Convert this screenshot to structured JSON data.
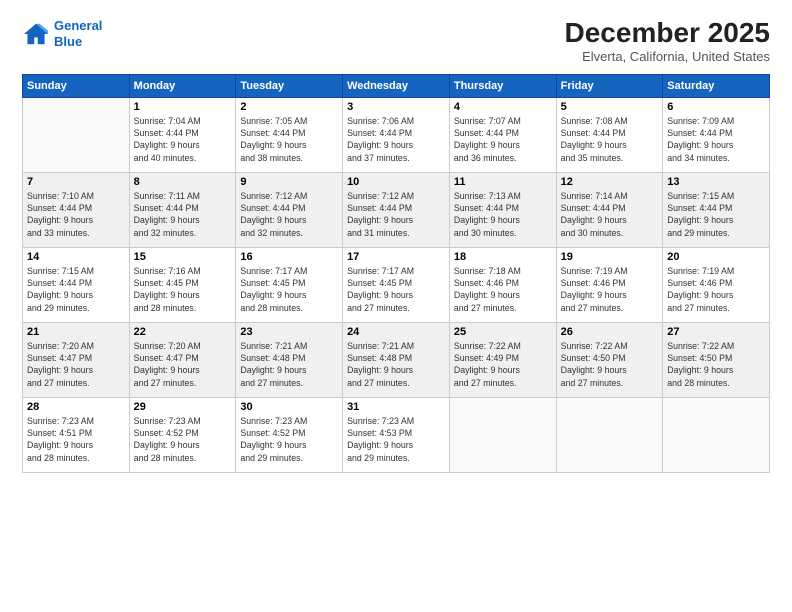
{
  "logo": {
    "line1": "General",
    "line2": "Blue"
  },
  "title": "December 2025",
  "subtitle": "Elverta, California, United States",
  "days_header": [
    "Sunday",
    "Monday",
    "Tuesday",
    "Wednesday",
    "Thursday",
    "Friday",
    "Saturday"
  ],
  "weeks": [
    [
      {
        "day": "",
        "info": ""
      },
      {
        "day": "1",
        "info": "Sunrise: 7:04 AM\nSunset: 4:44 PM\nDaylight: 9 hours\nand 40 minutes."
      },
      {
        "day": "2",
        "info": "Sunrise: 7:05 AM\nSunset: 4:44 PM\nDaylight: 9 hours\nand 38 minutes."
      },
      {
        "day": "3",
        "info": "Sunrise: 7:06 AM\nSunset: 4:44 PM\nDaylight: 9 hours\nand 37 minutes."
      },
      {
        "day": "4",
        "info": "Sunrise: 7:07 AM\nSunset: 4:44 PM\nDaylight: 9 hours\nand 36 minutes."
      },
      {
        "day": "5",
        "info": "Sunrise: 7:08 AM\nSunset: 4:44 PM\nDaylight: 9 hours\nand 35 minutes."
      },
      {
        "day": "6",
        "info": "Sunrise: 7:09 AM\nSunset: 4:44 PM\nDaylight: 9 hours\nand 34 minutes."
      }
    ],
    [
      {
        "day": "7",
        "info": "Sunrise: 7:10 AM\nSunset: 4:44 PM\nDaylight: 9 hours\nand 33 minutes."
      },
      {
        "day": "8",
        "info": "Sunrise: 7:11 AM\nSunset: 4:44 PM\nDaylight: 9 hours\nand 32 minutes."
      },
      {
        "day": "9",
        "info": "Sunrise: 7:12 AM\nSunset: 4:44 PM\nDaylight: 9 hours\nand 32 minutes."
      },
      {
        "day": "10",
        "info": "Sunrise: 7:12 AM\nSunset: 4:44 PM\nDaylight: 9 hours\nand 31 minutes."
      },
      {
        "day": "11",
        "info": "Sunrise: 7:13 AM\nSunset: 4:44 PM\nDaylight: 9 hours\nand 30 minutes."
      },
      {
        "day": "12",
        "info": "Sunrise: 7:14 AM\nSunset: 4:44 PM\nDaylight: 9 hours\nand 30 minutes."
      },
      {
        "day": "13",
        "info": "Sunrise: 7:15 AM\nSunset: 4:44 PM\nDaylight: 9 hours\nand 29 minutes."
      }
    ],
    [
      {
        "day": "14",
        "info": "Sunrise: 7:15 AM\nSunset: 4:44 PM\nDaylight: 9 hours\nand 29 minutes."
      },
      {
        "day": "15",
        "info": "Sunrise: 7:16 AM\nSunset: 4:45 PM\nDaylight: 9 hours\nand 28 minutes."
      },
      {
        "day": "16",
        "info": "Sunrise: 7:17 AM\nSunset: 4:45 PM\nDaylight: 9 hours\nand 28 minutes."
      },
      {
        "day": "17",
        "info": "Sunrise: 7:17 AM\nSunset: 4:45 PM\nDaylight: 9 hours\nand 27 minutes."
      },
      {
        "day": "18",
        "info": "Sunrise: 7:18 AM\nSunset: 4:46 PM\nDaylight: 9 hours\nand 27 minutes."
      },
      {
        "day": "19",
        "info": "Sunrise: 7:19 AM\nSunset: 4:46 PM\nDaylight: 9 hours\nand 27 minutes."
      },
      {
        "day": "20",
        "info": "Sunrise: 7:19 AM\nSunset: 4:46 PM\nDaylight: 9 hours\nand 27 minutes."
      }
    ],
    [
      {
        "day": "21",
        "info": "Sunrise: 7:20 AM\nSunset: 4:47 PM\nDaylight: 9 hours\nand 27 minutes."
      },
      {
        "day": "22",
        "info": "Sunrise: 7:20 AM\nSunset: 4:47 PM\nDaylight: 9 hours\nand 27 minutes."
      },
      {
        "day": "23",
        "info": "Sunrise: 7:21 AM\nSunset: 4:48 PM\nDaylight: 9 hours\nand 27 minutes."
      },
      {
        "day": "24",
        "info": "Sunrise: 7:21 AM\nSunset: 4:48 PM\nDaylight: 9 hours\nand 27 minutes."
      },
      {
        "day": "25",
        "info": "Sunrise: 7:22 AM\nSunset: 4:49 PM\nDaylight: 9 hours\nand 27 minutes."
      },
      {
        "day": "26",
        "info": "Sunrise: 7:22 AM\nSunset: 4:50 PM\nDaylight: 9 hours\nand 27 minutes."
      },
      {
        "day": "27",
        "info": "Sunrise: 7:22 AM\nSunset: 4:50 PM\nDaylight: 9 hours\nand 28 minutes."
      }
    ],
    [
      {
        "day": "28",
        "info": "Sunrise: 7:23 AM\nSunset: 4:51 PM\nDaylight: 9 hours\nand 28 minutes."
      },
      {
        "day": "29",
        "info": "Sunrise: 7:23 AM\nSunset: 4:52 PM\nDaylight: 9 hours\nand 28 minutes."
      },
      {
        "day": "30",
        "info": "Sunrise: 7:23 AM\nSunset: 4:52 PM\nDaylight: 9 hours\nand 29 minutes."
      },
      {
        "day": "31",
        "info": "Sunrise: 7:23 AM\nSunset: 4:53 PM\nDaylight: 9 hours\nand 29 minutes."
      },
      {
        "day": "",
        "info": ""
      },
      {
        "day": "",
        "info": ""
      },
      {
        "day": "",
        "info": ""
      }
    ]
  ]
}
